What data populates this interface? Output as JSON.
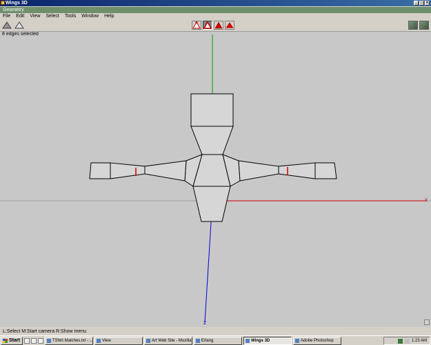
{
  "window": {
    "title": "Wings 3D",
    "minimize": "_",
    "maximize": "□",
    "close": "×"
  },
  "geometry_bar": {
    "label": "Geometry"
  },
  "menu": [
    "File",
    "Edit",
    "View",
    "Select",
    "Tools",
    "Window",
    "Help"
  ],
  "toolbar": {
    "modes": [
      "vertex-mode",
      "edge-mode",
      "face-mode",
      "body-mode"
    ],
    "active_mode": "edge-mode"
  },
  "viewport": {
    "selection_info": "8 edges selected",
    "axes": {
      "x_label": "x",
      "z_label": "z"
    },
    "colors": {
      "background": "#c8c8c8",
      "mesh_face": "#d6d6d6",
      "mesh_edge": "#000000",
      "selected_edge": "#cc0000",
      "x_axis": "#cc0000",
      "y_axis": "#00a000",
      "z_axis": "#0000cc"
    }
  },
  "status": {
    "text": "L:Select   M:Start camera   R:Show menu"
  },
  "taskbar": {
    "start": "Start",
    "tasks": [
      "TShirt Matches.txt - ...",
      "View",
      "Art Web Site - Mozilla",
      "Erlang",
      "Wings 3D",
      "Adobe Photoshop"
    ],
    "active_task": "Wings 3D",
    "clock": "1:23 AM"
  }
}
